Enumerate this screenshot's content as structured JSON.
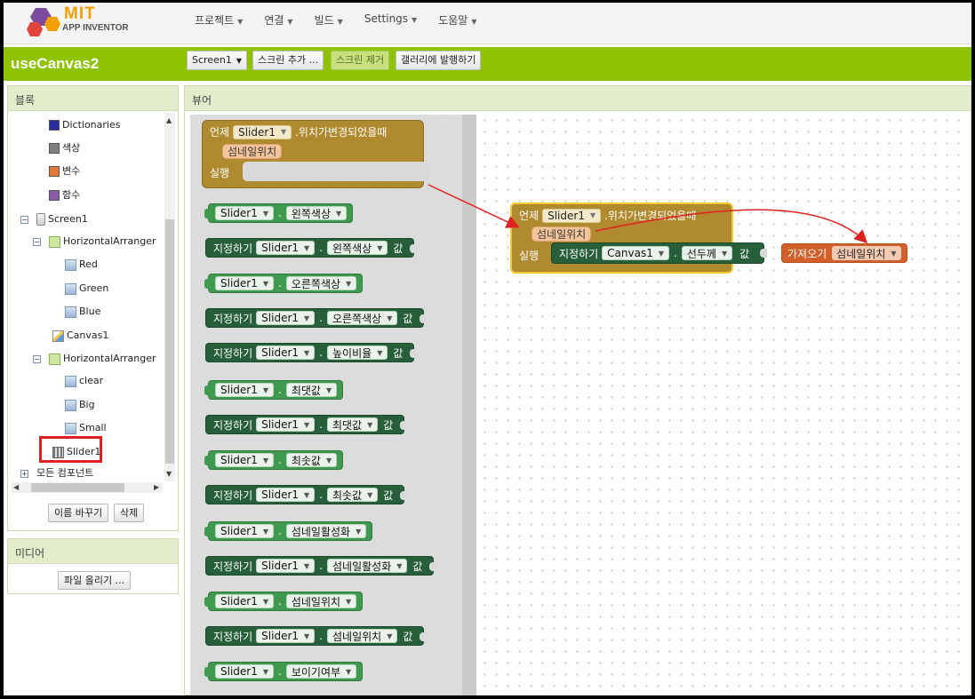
{
  "app": {
    "logo_mit": "MIT",
    "logo_sub": "APP INVENTOR",
    "project_name": "useCanvas2"
  },
  "menus": [
    "프로젝트",
    "연결",
    "빌드",
    "Settings",
    "도움말"
  ],
  "toolbar": {
    "screen": "Screen1",
    "add_screen": "스크린 추가 ...",
    "remove_screen": "스크린 제거",
    "publish": "갤러리에 발행하기"
  },
  "blocks_panel": {
    "title": "블록",
    "tree": {
      "dictionaries": "Dictionaries",
      "color": "색상",
      "variables": "변수",
      "procedures": "함수",
      "screen1": "Screen1",
      "arr1": "HorizontalArranger",
      "red": "Red",
      "green": "Green",
      "blue": "Blue",
      "canvas1": "Canvas1",
      "arr2": "HorizontalArranger",
      "clear": "clear",
      "big": "Big",
      "small": "Small",
      "slider1": "Slider1",
      "all_components": "모든 컴포넌트"
    },
    "rename": "이름 바꾸기",
    "delete": "삭제"
  },
  "media_panel": {
    "title": "미디어",
    "upload": "파일 올리기 ..."
  },
  "viewer": {
    "title": "뷰어",
    "flyout_event": {
      "when": "언제",
      "component": "Slider1",
      "event": ".위치가변경되었을때",
      "param": "섬네일위치",
      "do": "실행"
    },
    "flyout_blocks": [
      {
        "type": "get",
        "component": "Slider1",
        "prop": "왼쪽색상"
      },
      {
        "type": "set",
        "component": "Slider1",
        "prop": "왼쪽색상"
      },
      {
        "type": "get",
        "component": "Slider1",
        "prop": "오른쪽색상"
      },
      {
        "type": "set",
        "component": "Slider1",
        "prop": "오른쪽색상"
      },
      {
        "type": "set",
        "component": "Slider1",
        "prop": "높이비율"
      },
      {
        "type": "get",
        "component": "Slider1",
        "prop": "최댓값"
      },
      {
        "type": "set",
        "component": "Slider1",
        "prop": "최댓값"
      },
      {
        "type": "get",
        "component": "Slider1",
        "prop": "최솟값"
      },
      {
        "type": "set",
        "component": "Slider1",
        "prop": "최솟값"
      },
      {
        "type": "get",
        "component": "Slider1",
        "prop": "섬네일활성화"
      },
      {
        "type": "set",
        "component": "Slider1",
        "prop": "섬네일활성화"
      },
      {
        "type": "get",
        "component": "Slider1",
        "prop": "섬네일위치"
      },
      {
        "type": "set",
        "component": "Slider1",
        "prop": "섬네일위치"
      },
      {
        "type": "get",
        "component": "Slider1",
        "prop": "보이기여부"
      }
    ],
    "set_word": "지정하기",
    "to_word": "값",
    "ws_event": {
      "when": "언제",
      "component": "Slider1",
      "event": ".위치가변경되었을때",
      "param": "섬네일위치",
      "do": "실행",
      "set_word": "지정하기",
      "set_component": "Canvas1",
      "set_prop": "선두께",
      "to_word": "값",
      "get_word": "가져오기",
      "get_var": "섬네일위치"
    }
  },
  "colors": {
    "accent_green": "#8fc202",
    "block_green": "#3f9a4f",
    "block_dark_green": "#275f3a",
    "event_gold": "#b08a2e",
    "variable_orange": "#d35f2b",
    "annotation_red": "#e02020"
  }
}
